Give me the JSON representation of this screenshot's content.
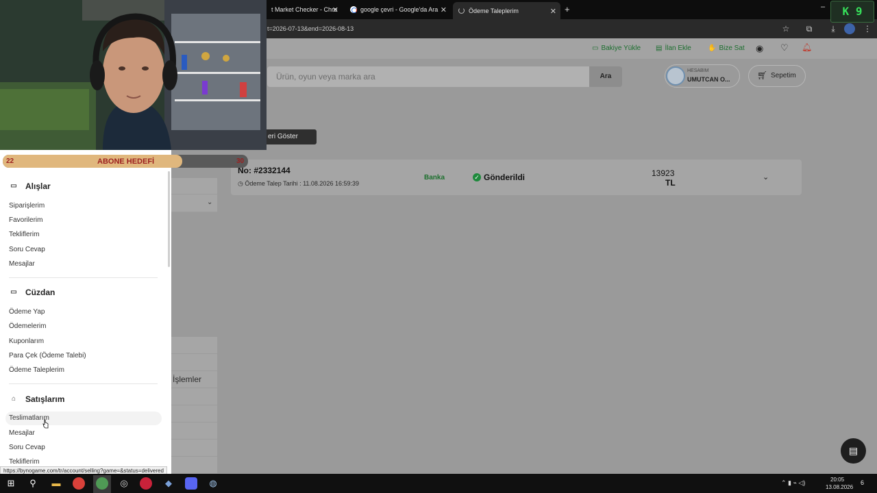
{
  "browser": {
    "tabs": [
      {
        "title": "t Market Checker - Chro",
        "close": "✕"
      },
      {
        "title": "google çevri - Google'da Ara",
        "close": "✕"
      },
      {
        "title": "Ödeme Taleplerim",
        "close": "✕"
      }
    ],
    "new_tab": "+",
    "address": "t=2026-07-13&end=2026-08-13",
    "window_min": "–"
  },
  "header": {
    "links": [
      "Bakiye Yükle",
      "İlan Ekle",
      "Bize Sat"
    ],
    "search_placeholder": "Ürün, oyun veya marka ara",
    "search_button": "Ara",
    "account_small": "HESABIM",
    "account_name": "UMUTCAN O...",
    "cart": "Sepetim"
  },
  "main": {
    "show_button": "eri Göster",
    "payment": {
      "no": "No:  #2332144",
      "date": "Ödeme Talep Tarihi : 11.08.2026 16:59:39",
      "method": "Banka",
      "status": "Gönderildi",
      "amount": "13923",
      "currency": "TL"
    },
    "behind_text": "İşlemler"
  },
  "sidebar": {
    "sections": [
      {
        "title": "Alışlar",
        "items": [
          "Siparişlerim",
          "Favorilerim",
          "Tekliflerim",
          "Soru Cevap",
          "Mesajlar"
        ]
      },
      {
        "title": "Cüzdan",
        "items": [
          "Ödeme Yap",
          "Ödemelerim",
          "Kuponlarım",
          "Para Çek (Ödeme Talebi)",
          "Ödeme Taleplerim"
        ]
      },
      {
        "title": "Satışlarım",
        "items": [
          "Teslimatlarım",
          "Mesajlar",
          "Soru Cevap",
          "Tekliflerim"
        ]
      }
    ]
  },
  "overlay": {
    "goal_title": "ABONE HEDEFİ",
    "goal_current": "22",
    "goal_target": "30",
    "k_badge": "K  9"
  },
  "status_url": "https://bynogame.com/tr/account/selling?game=&status=delivered",
  "taskbar": {
    "time": "20:05",
    "date": "13.08.2026",
    "notif": "6"
  }
}
